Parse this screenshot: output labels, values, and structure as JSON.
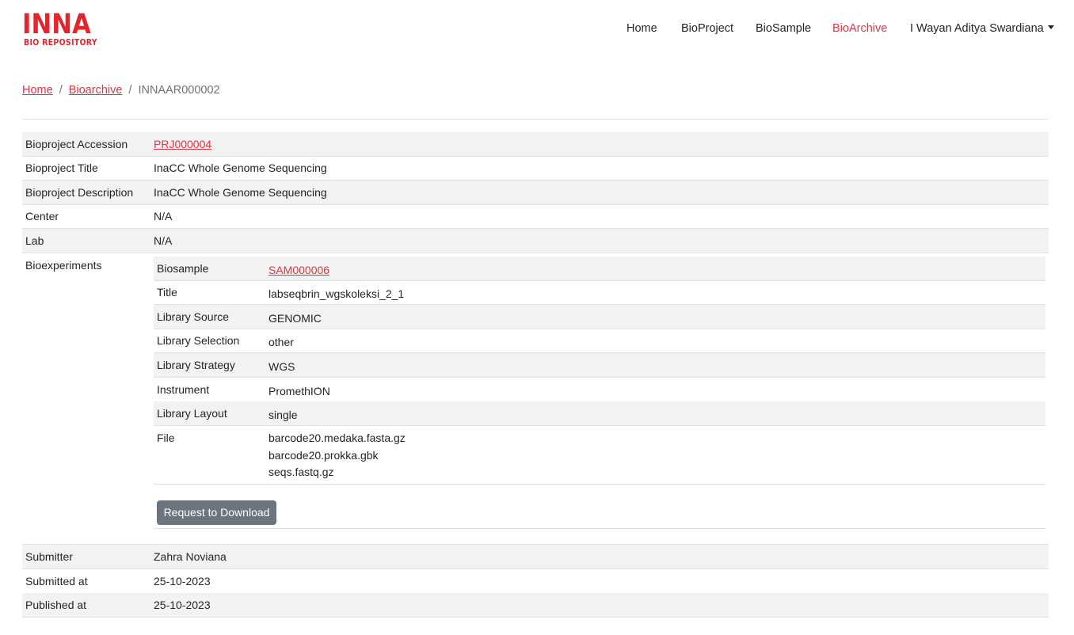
{
  "brand": {
    "logo_text": "INNA",
    "logo_subtitle": "BIO REPOSITORY",
    "color": "#e3262c"
  },
  "nav": {
    "items": [
      {
        "label": "Home"
      },
      {
        "label": "BioProject"
      },
      {
        "label": "BioSample"
      },
      {
        "label": "BioArchive",
        "active": true
      }
    ],
    "user": "I Wayan Aditya Swardiana"
  },
  "breadcrumb": {
    "home": "Home",
    "bioarchive": "Bioarchive",
    "current": "INNAAR000002"
  },
  "details": {
    "accession": {
      "label": "Bioproject Accession",
      "value": "PRJ000004"
    },
    "title": {
      "label": "Bioproject Title",
      "value": "InaCC Whole Genome Sequencing"
    },
    "description": {
      "label": "Bioproject Description",
      "value": "InaCC Whole Genome Sequencing"
    },
    "center": {
      "label": "Center",
      "value": "N/A"
    },
    "lab": {
      "label": "Lab",
      "value": "N/A"
    },
    "bioexperiments_label": "Bioexperiments",
    "submitter": {
      "label": "Submitter",
      "value": "Zahra Noviana"
    },
    "submitted_at": {
      "label": "Submitted at",
      "value": "25-10-2023"
    },
    "published_at": {
      "label": "Published at",
      "value": "25-10-2023"
    }
  },
  "experiment": {
    "biosample": {
      "label": "Biosample",
      "value": "SAM000006"
    },
    "title": {
      "label": "Title",
      "value": "labseqbrin_wgskoleksi_2_1"
    },
    "library_source": {
      "label": "Library Source",
      "value": "GENOMIC"
    },
    "library_selection": {
      "label": "Library Selection",
      "value": "other"
    },
    "library_strategy": {
      "label": "Library Strategy",
      "value": "WGS"
    },
    "instrument": {
      "label": "Instrument",
      "value": "PromethION"
    },
    "library_layout": {
      "label": "Library Layout",
      "value": "single"
    },
    "file": {
      "label": "File",
      "values": [
        "barcode20.medaka.fasta.gz",
        "barcode20.prokka.gbk",
        "seqs.fastq.gz"
      ]
    },
    "download_button": "Request to Download"
  },
  "colors": {
    "accent": "#dc3545",
    "stripe": "#f2f2f2",
    "button": "#6c757d"
  }
}
